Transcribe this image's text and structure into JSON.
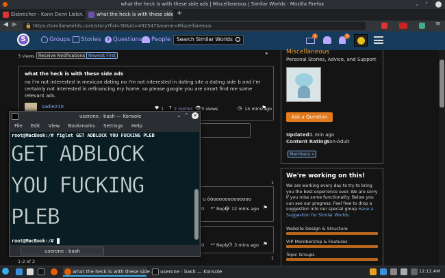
{
  "window": {
    "title": "what the heck is with these side ads | Miscellaneous | Similar Worlds - Mozilla Firefox"
  },
  "browser": {
    "tabs": [
      {
        "label": "Eisbrecher - Kann Denn Lieb...",
        "color": "#d33"
      },
      {
        "label": "what the heck is with these side a",
        "color": "#6a4fb0"
      }
    ],
    "new_tab": "+",
    "url": "https://similarworlds.com/story?fid=30&id=492547&name=Miscellaneous"
  },
  "site": {
    "logo": "S",
    "nav": [
      "Groups",
      "Stories",
      "Questions",
      "People"
    ],
    "search_placeholder": "Search Similar Worlds",
    "badges": {
      "messages": "1",
      "notifications": "5"
    }
  },
  "post": {
    "views": "3 views",
    "receive_notifications": "Receive Notifications",
    "newest_first": "Newest First",
    "title": "what the heck is with these side ads",
    "body": "no i'm not interested in mexican dating no i'm not interested in dating site a dating side b and i'm certainly not interested in refinancing my home. so please google you are smart find me some relevant ads.",
    "author": "sadie210",
    "likes": "1",
    "replies": "2 replies",
    "post_views": "3 views",
    "time": "14 mins ago"
  },
  "comments": [
    {
      "text": "u òòooooooooooooo",
      "likes": "0",
      "reply": "Reply",
      "time": "12 mins ago"
    },
    {
      "text": "",
      "likes": "0",
      "reply": "Reply",
      "time": "3 mins ago"
    }
  ],
  "pagination": {
    "count": "1",
    "count2": "1",
    "range": "1-2 of 2"
  },
  "sidebar": {
    "group_title": "Miscellaneous",
    "group_subtitle": "Personal Stories, Advice, and Support",
    "ask_button": "Ask a Question",
    "updated_label": "Updated:",
    "updated_value": "1 min ago",
    "rating_label": "Content Rating:",
    "rating_value": "Non-Adult",
    "members_button": "Members »",
    "working_title": "We're working on this!",
    "working_text": "We are working every day to try to bring you the best experience ever. We are sorry if you miss some functionality. Below you can see our progress. Feel free to drop a suggestion into our special group",
    "suggestion_link": "Have a Suggestion for Similar Worlds.",
    "progress": [
      {
        "label": "Website Design & Structure",
        "value": 1.0
      },
      {
        "label": "VIP Membership & Features",
        "value": 1.0
      },
      {
        "label": "Topic Groups",
        "value": 1.0
      }
    ]
  },
  "konsole": {
    "title": "userone : bash — Konsole",
    "menu": [
      "File",
      "Edit",
      "View",
      "Bookmarks",
      "Settings",
      "Help"
    ],
    "command_line": "root@MacBook:/# figlet GET ADBLOCK YOU FUCKING PLEB",
    "ascii_lines": [
      "GET ADBLOCK",
      "YOU FUCKING",
      "PLEB"
    ],
    "prompt": "root@MacBook:/#",
    "tab_label": "userone : bash"
  },
  "taskbar": {
    "tasks": [
      "what the heck is with these side a...",
      "userone : bash — Konsole"
    ],
    "clock": "12:12 AM"
  }
}
